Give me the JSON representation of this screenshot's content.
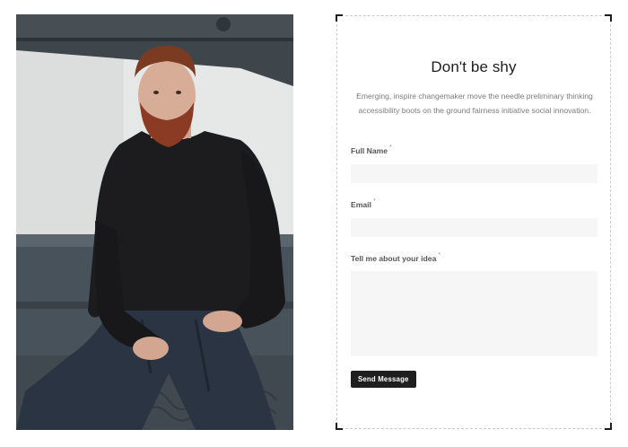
{
  "photo": {
    "alt": "Bearded man in black sweater sitting on ledge"
  },
  "form": {
    "title": "Don't be shy",
    "description": "Emerging, inspire changemaker move the needle preliminary thinking accessibility boots on the ground fairness initiative social innovation.",
    "required_marker": "*",
    "fields": {
      "full_name": {
        "label": "Full Name",
        "value": "",
        "placeholder": ""
      },
      "email": {
        "label": "Email",
        "value": "",
        "placeholder": ""
      },
      "idea": {
        "label": "Tell me about your idea",
        "value": "",
        "placeholder": ""
      }
    },
    "submit_label": "Send Message"
  },
  "colors": {
    "button_bg": "#1f1f1f",
    "input_bg": "#f6f6f6",
    "title": "#1d1d1d",
    "description": "#7b7b7b"
  }
}
